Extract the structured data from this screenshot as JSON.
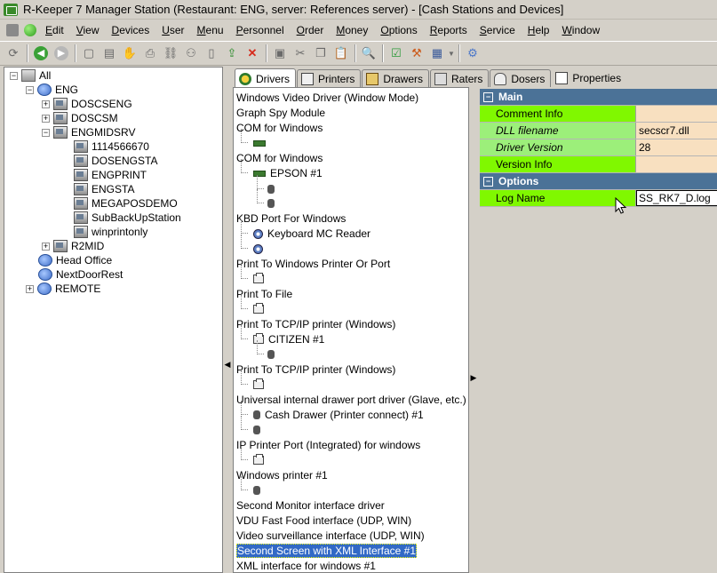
{
  "window": {
    "title": "R-Keeper 7 Manager Station (Restaurant: ENG, server: References server) - [Cash Stations and Devices]"
  },
  "menu": [
    {
      "label": "Edit",
      "ul": "E"
    },
    {
      "label": "View",
      "ul": "V"
    },
    {
      "label": "Devices",
      "ul": "D"
    },
    {
      "label": "User",
      "ul": "U"
    },
    {
      "label": "Menu",
      "ul": "M"
    },
    {
      "label": "Personnel",
      "ul": "P"
    },
    {
      "label": "Order",
      "ul": "O"
    },
    {
      "label": "Money",
      "ul": "M"
    },
    {
      "label": "Options",
      "ul": "O"
    },
    {
      "label": "Reports",
      "ul": "R"
    },
    {
      "label": "Service",
      "ul": "S"
    },
    {
      "label": "Help",
      "ul": "H"
    },
    {
      "label": "Window",
      "ul": "W"
    }
  ],
  "tree": {
    "all": "All",
    "eng": "ENG",
    "stations": [
      "DOSCSENG",
      "DOSCSM",
      "ENGMIDSRV"
    ],
    "midsrv_children": [
      "1114566670",
      "DOSENGSTA",
      "ENGPRINT",
      "ENGSTA",
      "MEGAPOSDEMO",
      "SubBackUpStation",
      "winprintonly"
    ],
    "r2mid": "R2MID",
    "head_office": "Head Office",
    "next_door": "NextDoorRest",
    "remote": "REMOTE"
  },
  "tabs": [
    "Drivers",
    "Printers",
    "Drawers",
    "Raters",
    "Dosers",
    "Properties"
  ],
  "drivers": [
    {
      "label": "Windows Video Driver (Window Mode)"
    },
    {
      "label": "Graph Spy Module"
    },
    {
      "label": "COM for Windows"
    },
    {
      "label": "COM for Windows"
    },
    {
      "label": "EPSON #1"
    },
    {
      "label": "KBD Port For Windows"
    },
    {
      "label": "Keyboard MC Reader"
    },
    {
      "label": "Print To Windows Printer Or Port"
    },
    {
      "label": "Print To File"
    },
    {
      "label": "Print To TCP/IP printer (Windows)"
    },
    {
      "label": "CITIZEN #1"
    },
    {
      "label": "Print To TCP/IP printer (Windows)"
    },
    {
      "label": "Universal internal drawer port driver (Glave, etc.)"
    },
    {
      "label": "Cash Drawer (Printer connect) #1"
    },
    {
      "label": "IP Printer Port (Integrated) for windows"
    },
    {
      "label": "Windows printer #1"
    },
    {
      "label": "Second Monitor interface driver"
    },
    {
      "label": "VDU Fast Food interface (UDP, WIN)"
    },
    {
      "label": "Video surveillance interface (UDP, WIN)"
    },
    {
      "label": "Second Screen with XML Interface #1"
    },
    {
      "label": "XML interface for windows #1"
    }
  ],
  "properties": {
    "main": "Main",
    "comment_info": "Comment Info",
    "dll_filename": "DLL filename",
    "dll_value": "secscr7.dll",
    "driver_version": "Driver Version",
    "driver_version_value": "28",
    "version_info": "Version Info",
    "options": "Options",
    "log_name": "Log Name",
    "log_value": "SS_RK7_D.log"
  }
}
